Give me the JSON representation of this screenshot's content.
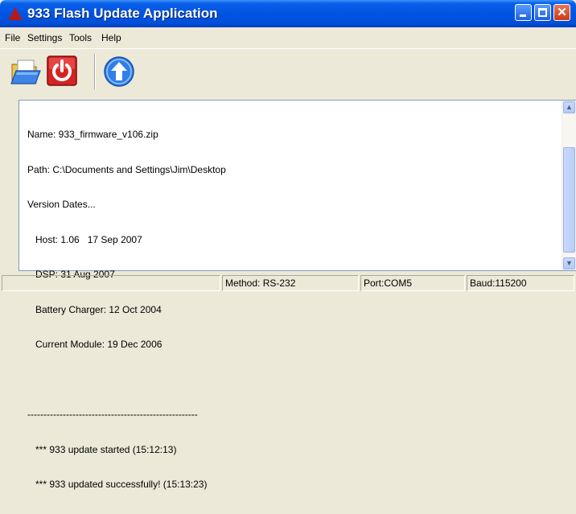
{
  "window": {
    "title": "933 Flash Update Application"
  },
  "menu": [
    "File",
    "Settings",
    "Tools",
    "Help"
  ],
  "toolbar": {
    "icons": [
      "open-folder-icon",
      "power-icon",
      "upload-arrow-icon"
    ]
  },
  "log": {
    "lines": [
      "Name: 933_firmware_v106.zip",
      "Path: C:\\Documents and Settings\\Jim\\Desktop",
      "Version Dates...",
      "   Host: 1.06   17 Sep 2007",
      "   DSP: 31 Aug 2007",
      "   Battery Charger: 12 Oct 2004",
      "   Current Module: 19 Dec 2006",
      "",
      "-----------------------------------------------------",
      "   *** 933 update started (15:12:13)",
      "   *** 933 updated successfully! (15:13:23)"
    ]
  },
  "status": {
    "method": "Method: RS-232",
    "port": "Port:COM5",
    "baud": "Baud:115200"
  },
  "colors": {
    "title_bar": "#0054e3",
    "close_button": "#c93a18",
    "stop_button": "#d32424",
    "upload_button": "#2f7fe8"
  }
}
